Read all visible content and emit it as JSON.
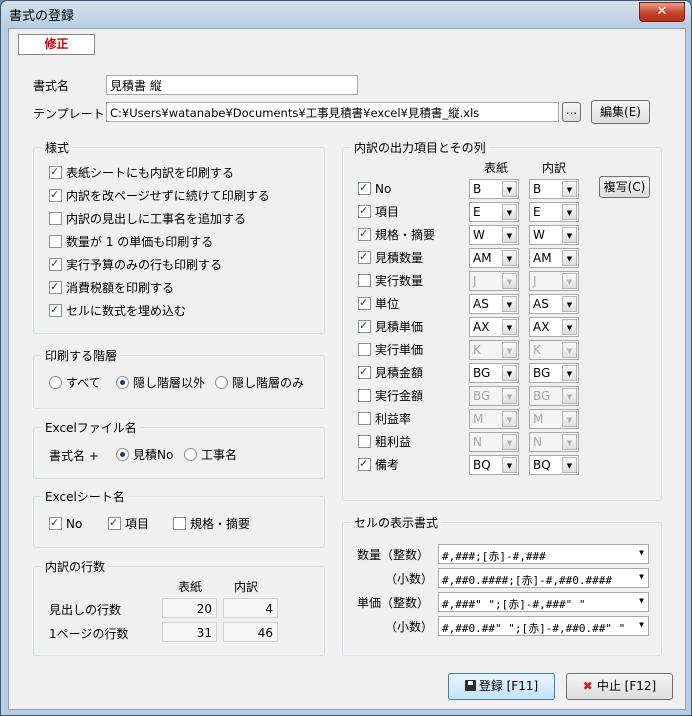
{
  "window": {
    "title": "書式の登録",
    "close_glyph": "✕"
  },
  "mode_label": "修正",
  "form": {
    "format_name_label": "書式名",
    "format_name_value": "見積書 縦",
    "template_label": "テンプレート",
    "template_value": "C:¥Users¥watanabe¥Documents¥工事見積書¥excel¥見積書_縦.xls",
    "browse_label": "...",
    "edit_label": "編集(E)"
  },
  "style_group": {
    "title": "様式",
    "options": [
      {
        "label": "表紙シートにも内訳を印刷する",
        "checked": true
      },
      {
        "label": "内訳を改ページせずに続けて印刷する",
        "checked": true
      },
      {
        "label": "内訳の見出しに工事名を追加する",
        "checked": false
      },
      {
        "label": "数量が 1 の単価も印刷する",
        "checked": false
      },
      {
        "label": "実行予算のみの行も印刷する",
        "checked": true
      },
      {
        "label": "消費税額を印刷する",
        "checked": true
      },
      {
        "label": "セルに数式を埋め込む",
        "checked": true
      }
    ]
  },
  "level_group": {
    "title": "印刷する階層",
    "options": [
      {
        "label": "すべて",
        "selected": false
      },
      {
        "label": "隠し階層以外",
        "selected": true
      },
      {
        "label": "隠し階層のみ",
        "selected": false
      }
    ]
  },
  "excel_file_group": {
    "title": "Excelファイル名",
    "prefix": "書式名 +",
    "options": [
      {
        "label": "見積No",
        "selected": true
      },
      {
        "label": "工事名",
        "selected": false
      }
    ]
  },
  "excel_sheet_group": {
    "title": "Excelシート名",
    "options": [
      {
        "label": "No",
        "checked": true
      },
      {
        "label": "項目",
        "checked": true
      },
      {
        "label": "規格・摘要",
        "checked": false
      }
    ]
  },
  "rows_group": {
    "title": "内訳の行数",
    "col_cover": "表紙",
    "col_detail": "内訳",
    "rows": [
      {
        "label": "見出しの行数",
        "cover": "20",
        "detail": "4"
      },
      {
        "label": "1ページの行数",
        "cover": "31",
        "detail": "46"
      }
    ]
  },
  "output_group": {
    "title": "内訳の出力項目とその列",
    "col_cover": "表紙",
    "col_detail": "内訳",
    "copy_label": "複写(C)",
    "items": [
      {
        "label": "No",
        "checked": true,
        "cover": "B",
        "detail": "B"
      },
      {
        "label": "項目",
        "checked": true,
        "cover": "E",
        "detail": "E"
      },
      {
        "label": "規格・摘要",
        "checked": true,
        "cover": "W",
        "detail": "W"
      },
      {
        "label": "見積数量",
        "checked": true,
        "cover": "AM",
        "detail": "AM"
      },
      {
        "label": "実行数量",
        "checked": false,
        "cover": "J",
        "detail": "J"
      },
      {
        "label": "単位",
        "checked": true,
        "cover": "AS",
        "detail": "AS"
      },
      {
        "label": "見積単価",
        "checked": true,
        "cover": "AX",
        "detail": "AX"
      },
      {
        "label": "実行単価",
        "checked": false,
        "cover": "K",
        "detail": "K"
      },
      {
        "label": "見積金額",
        "checked": true,
        "cover": "BG",
        "detail": "BG"
      },
      {
        "label": "実行金額",
        "checked": false,
        "cover": "BG",
        "detail": "BG"
      },
      {
        "label": "利益率",
        "checked": false,
        "cover": "M",
        "detail": "M"
      },
      {
        "label": "粗利益",
        "checked": false,
        "cover": "N",
        "detail": "N"
      },
      {
        "label": "備考",
        "checked": true,
        "cover": "BQ",
        "detail": "BQ"
      }
    ]
  },
  "cell_format_group": {
    "title": "セルの表示書式",
    "rows": [
      {
        "label": "数量（整数）",
        "value": "#,###;[赤]-#,###"
      },
      {
        "label": "（小数）",
        "value": "#,##0.####;[赤]-#,##0.####"
      },
      {
        "label": "単価（整数）",
        "value": "#,###\" \";[赤]-#,###\" \""
      },
      {
        "label": "（小数）",
        "value": "#,##0.##\" \";[赤]-#,##0.##\" \""
      }
    ]
  },
  "footer": {
    "register_label": "登録 [F11]",
    "cancel_label": "中止 [F12]"
  },
  "colors": {
    "mode_text": "#d40000",
    "accent": "#1d3c78",
    "close_red": "#c7432b"
  }
}
